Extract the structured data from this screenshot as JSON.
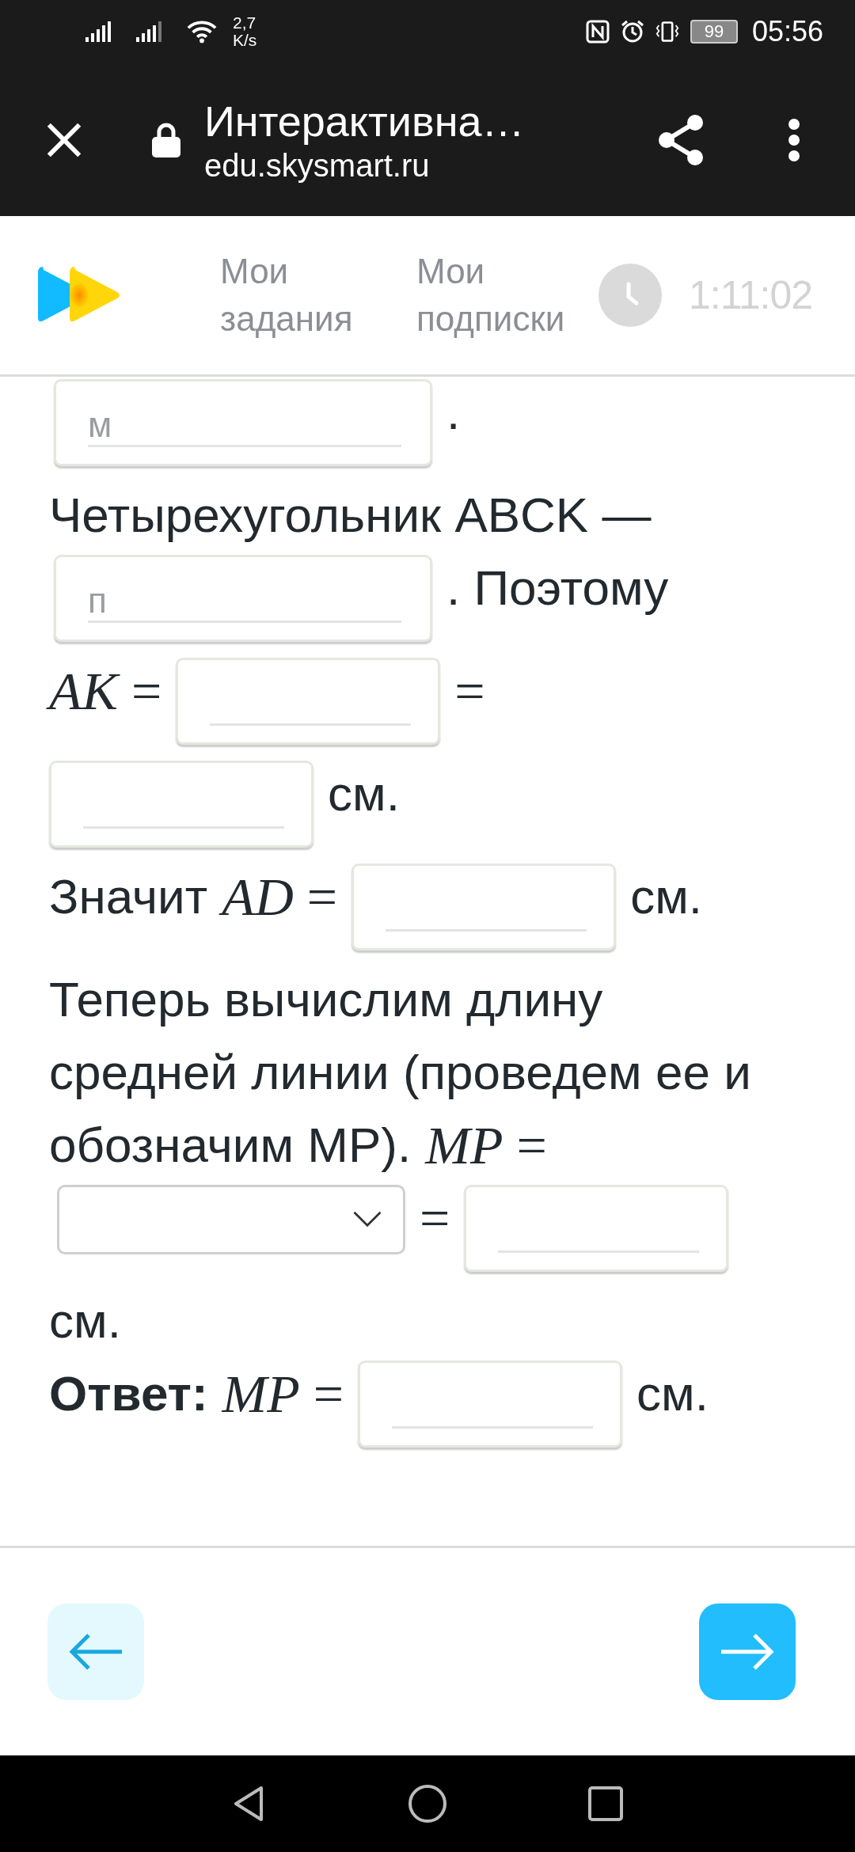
{
  "status_bar": {
    "speed_value": "2,7",
    "speed_unit": "K/s",
    "battery": "99",
    "time": "05:56"
  },
  "browser_bar": {
    "title": "Интерактивна…",
    "url": "edu.skysmart.ru"
  },
  "header": {
    "nav": [
      {
        "label": "Мои задания"
      },
      {
        "label": "Мои подписки"
      }
    ],
    "timer": "1:11:02"
  },
  "content": {
    "lines": [
      [
        {
          "kind": "input",
          "placeholder": "м"
        },
        {
          "kind": "text",
          "text": "."
        }
      ],
      [
        {
          "kind": "text",
          "text": "Четырехугольник ABCK —"
        }
      ],
      [
        {
          "kind": "input",
          "placeholder": "п"
        },
        {
          "kind": "text",
          "text": ". Поэтому"
        }
      ],
      [
        {
          "kind": "math",
          "text": "*AK* ="
        },
        {
          "kind": "input"
        },
        {
          "kind": "math",
          "text": "="
        }
      ],
      [
        {
          "kind": "input"
        },
        {
          "kind": "text",
          "text": "см."
        }
      ],
      [
        {
          "kind": "text",
          "text": "Значит"
        },
        {
          "kind": "math",
          "text": "*AD* ="
        },
        {
          "kind": "input"
        },
        {
          "kind": "text",
          "text": "см."
        }
      ],
      [
        {
          "kind": "text",
          "text": "Теперь вычислим длину"
        }
      ],
      [
        {
          "kind": "text",
          "text": "средней линии (проведем ее и"
        }
      ],
      [
        {
          "kind": "text",
          "text": "обозначим MP)."
        },
        {
          "kind": "math",
          "text": "*MP* ="
        }
      ],
      [
        {
          "kind": "select"
        },
        {
          "kind": "math",
          "text": "="
        },
        {
          "kind": "input"
        }
      ],
      [
        {
          "kind": "text",
          "text": "см."
        }
      ],
      [
        {
          "kind": "label",
          "text": "Ответ:"
        },
        {
          "kind": "math",
          "text": "*MP* ="
        },
        {
          "kind": "input"
        },
        {
          "kind": "text",
          "text": "см."
        }
      ]
    ]
  }
}
